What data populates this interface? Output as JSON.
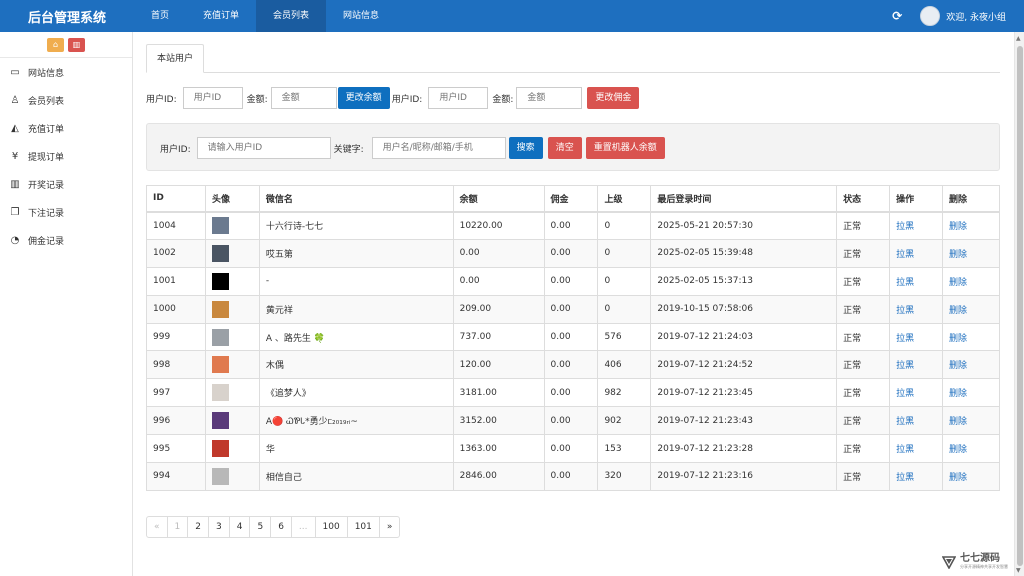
{
  "brand": "后台管理系统",
  "nav": [
    {
      "label": "首页",
      "active": false
    },
    {
      "label": "充值订单",
      "active": false
    },
    {
      "label": "会员列表",
      "active": true
    },
    {
      "label": "网站信息",
      "active": false
    }
  ],
  "topright": {
    "refresh_icon": "refresh-icon",
    "welcome": "欢迎, 永夜小组"
  },
  "sidebar": {
    "items": [
      {
        "label": "网站信息",
        "icon": "monitor-icon"
      },
      {
        "label": "会员列表",
        "icon": "user-icon"
      },
      {
        "label": "充值订单",
        "icon": "area-chart-icon"
      },
      {
        "label": "提现订单",
        "icon": "yen-icon"
      },
      {
        "label": "开奖记录",
        "icon": "bar-chart-icon"
      },
      {
        "label": "下注记录",
        "icon": "clone-icon"
      },
      {
        "label": "佣金记录",
        "icon": "pie-chart-icon"
      }
    ]
  },
  "tab": "本站用户",
  "balance_form": {
    "uid_label": "用户ID:",
    "uid_placeholder": "用户ID",
    "amount_label": "金额:",
    "amount_placeholder": "金额",
    "button": "更改余额"
  },
  "commission_form": {
    "uid_label": "用户ID:",
    "uid_placeholder": "用户ID",
    "amount_label": "金额:",
    "amount_placeholder": "金额",
    "button": "更改佣金"
  },
  "search": {
    "uid_label": "用户ID:",
    "uid_placeholder": "请输入用户ID",
    "keyword_label": "关键字:",
    "keyword_placeholder": "用户名/昵称/邮箱/手机",
    "search_button": "搜索",
    "clear_button": "清空",
    "reset_button": "重置机器人余额"
  },
  "table": {
    "headers": [
      "ID",
      "头像",
      "微信名",
      "余额",
      "佣金",
      "上级",
      "最后登录时间",
      "状态",
      "操作",
      "删除"
    ],
    "rows": [
      {
        "id": "1004",
        "name": "十六行诗-七七",
        "balance": "10220.00",
        "commission": "0.00",
        "parent": "0",
        "last_login": "2025-05-21 20:57:30",
        "status": "正常",
        "action": "拉黑",
        "delete": "删除",
        "avatar_color": "#6b7a8f"
      },
      {
        "id": "1002",
        "name": "哎五第",
        "balance": "0.00",
        "commission": "0.00",
        "parent": "0",
        "last_login": "2025-02-05 15:39:48",
        "status": "正常",
        "action": "拉黑",
        "delete": "删除",
        "avatar_color": "#4a5563"
      },
      {
        "id": "1001",
        "name": "-",
        "balance": "0.00",
        "commission": "0.00",
        "parent": "0",
        "last_login": "2025-02-05 15:37:13",
        "status": "正常",
        "action": "拉黑",
        "delete": "删除",
        "avatar_color": "#000000"
      },
      {
        "id": "1000",
        "name": "黄元祥",
        "balance": "209.00",
        "commission": "0.00",
        "parent": "0",
        "last_login": "2019-10-15 07:58:06",
        "status": "正常",
        "action": "拉黑",
        "delete": "删除",
        "avatar_color": "#c9883e"
      },
      {
        "id": "999",
        "name": "A 、路先生 🍀",
        "balance": "737.00",
        "commission": "0.00",
        "parent": "576",
        "last_login": "2019-07-12 21:24:03",
        "status": "正常",
        "action": "拉黑",
        "delete": "删除",
        "avatar_color": "#9aa0a6"
      },
      {
        "id": "998",
        "name": "木偶",
        "balance": "120.00",
        "commission": "0.00",
        "parent": "406",
        "last_login": "2019-07-12 21:24:52",
        "status": "正常",
        "action": "拉黑",
        "delete": "删除",
        "avatar_color": "#e07a4f"
      },
      {
        "id": "997",
        "name": "《追梦人》",
        "balance": "3181.00",
        "commission": "0.00",
        "parent": "982",
        "last_login": "2019-07-12 21:23:45",
        "status": "正常",
        "action": "拉黑",
        "delete": "删除",
        "avatar_color": "#d8d2cc"
      },
      {
        "id": "996",
        "name": "A🔴 ᏇᏈᏓ*勇少ᥴ₂₀₁₉ᵣᵢ~",
        "balance": "3152.00",
        "commission": "0.00",
        "parent": "902",
        "last_login": "2019-07-12 21:23:43",
        "status": "正常",
        "action": "拉黑",
        "delete": "删除",
        "avatar_color": "#5a3a7a"
      },
      {
        "id": "995",
        "name": "华",
        "balance": "1363.00",
        "commission": "0.00",
        "parent": "153",
        "last_login": "2019-07-12 21:23:28",
        "status": "正常",
        "action": "拉黑",
        "delete": "删除",
        "avatar_color": "#c0392b"
      },
      {
        "id": "994",
        "name": "相信自己",
        "balance": "2846.00",
        "commission": "0.00",
        "parent": "320",
        "last_login": "2019-07-12 21:23:16",
        "status": "正常",
        "action": "拉黑",
        "delete": "删除",
        "avatar_color": "#b8b8b8"
      }
    ]
  },
  "pagination": [
    "«",
    "1",
    "2",
    "3",
    "4",
    "5",
    "6",
    "...",
    "100",
    "101",
    "»"
  ],
  "watermark": {
    "title": "七七源码",
    "subtitle": "分享开源精神共享开发智慧"
  }
}
